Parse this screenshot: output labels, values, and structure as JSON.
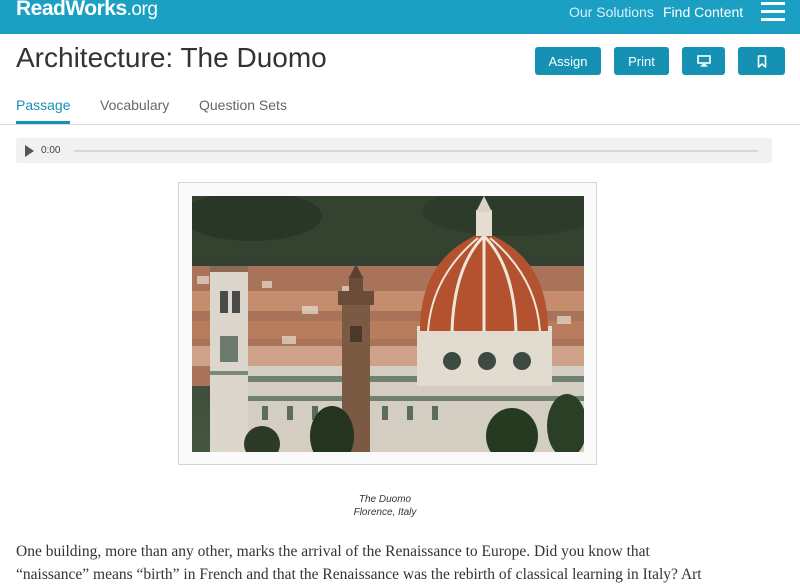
{
  "header": {
    "logo": "ReadWorks",
    "logo_suffix": ".org",
    "nav": {
      "solutions": "Our Solutions",
      "find_content": "Find Content"
    }
  },
  "page": {
    "title": "Architecture: The Duomo",
    "actions": {
      "assign": "Assign",
      "print": "Print"
    }
  },
  "tabs": [
    {
      "label": "Passage",
      "active": true
    },
    {
      "label": "Vocabulary",
      "active": false
    },
    {
      "label": "Question Sets",
      "active": false
    }
  ],
  "audio": {
    "time": "0:00"
  },
  "figure": {
    "caption_title": "The Duomo",
    "caption_location": "Florence, Italy"
  },
  "passage": {
    "line1": "One building, more than any other, marks the arrival of the Renaissance to Europe. Did you know that",
    "line2": "“naissance” means “birth” in French and that the Renaissance was the rebirth of classical learning in Italy? Art"
  },
  "icons": {
    "menu": "hamburger-icon",
    "present": "monitor-icon",
    "bookmark": "bookmark-icon",
    "play": "play-icon"
  },
  "colors": {
    "brand": "#1ba0c4",
    "button": "#1591b3",
    "active_tab": "#1591b3"
  }
}
